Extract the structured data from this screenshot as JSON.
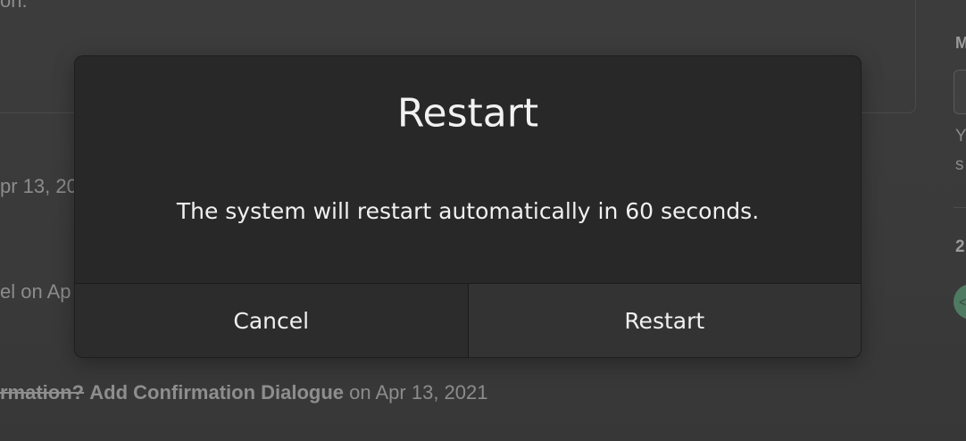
{
  "background": {
    "top_fragment": "on.",
    "date_fragment": "pr 13, 20",
    "author_fragment": "el on Ap",
    "activity": {
      "link_strike": "rmation?",
      "link_title": "Add Confirmation Dialogue",
      "suffix": " on Apr 13, 2021"
    },
    "sidebar": {
      "label": "M",
      "text1": "Y",
      "text2": "s",
      "count": "2",
      "avatar": "<"
    }
  },
  "dialog": {
    "title": "Restart",
    "message": "The system will restart automatically in 60 seconds.",
    "buttons": {
      "cancel": "Cancel",
      "restart": "Restart"
    }
  }
}
